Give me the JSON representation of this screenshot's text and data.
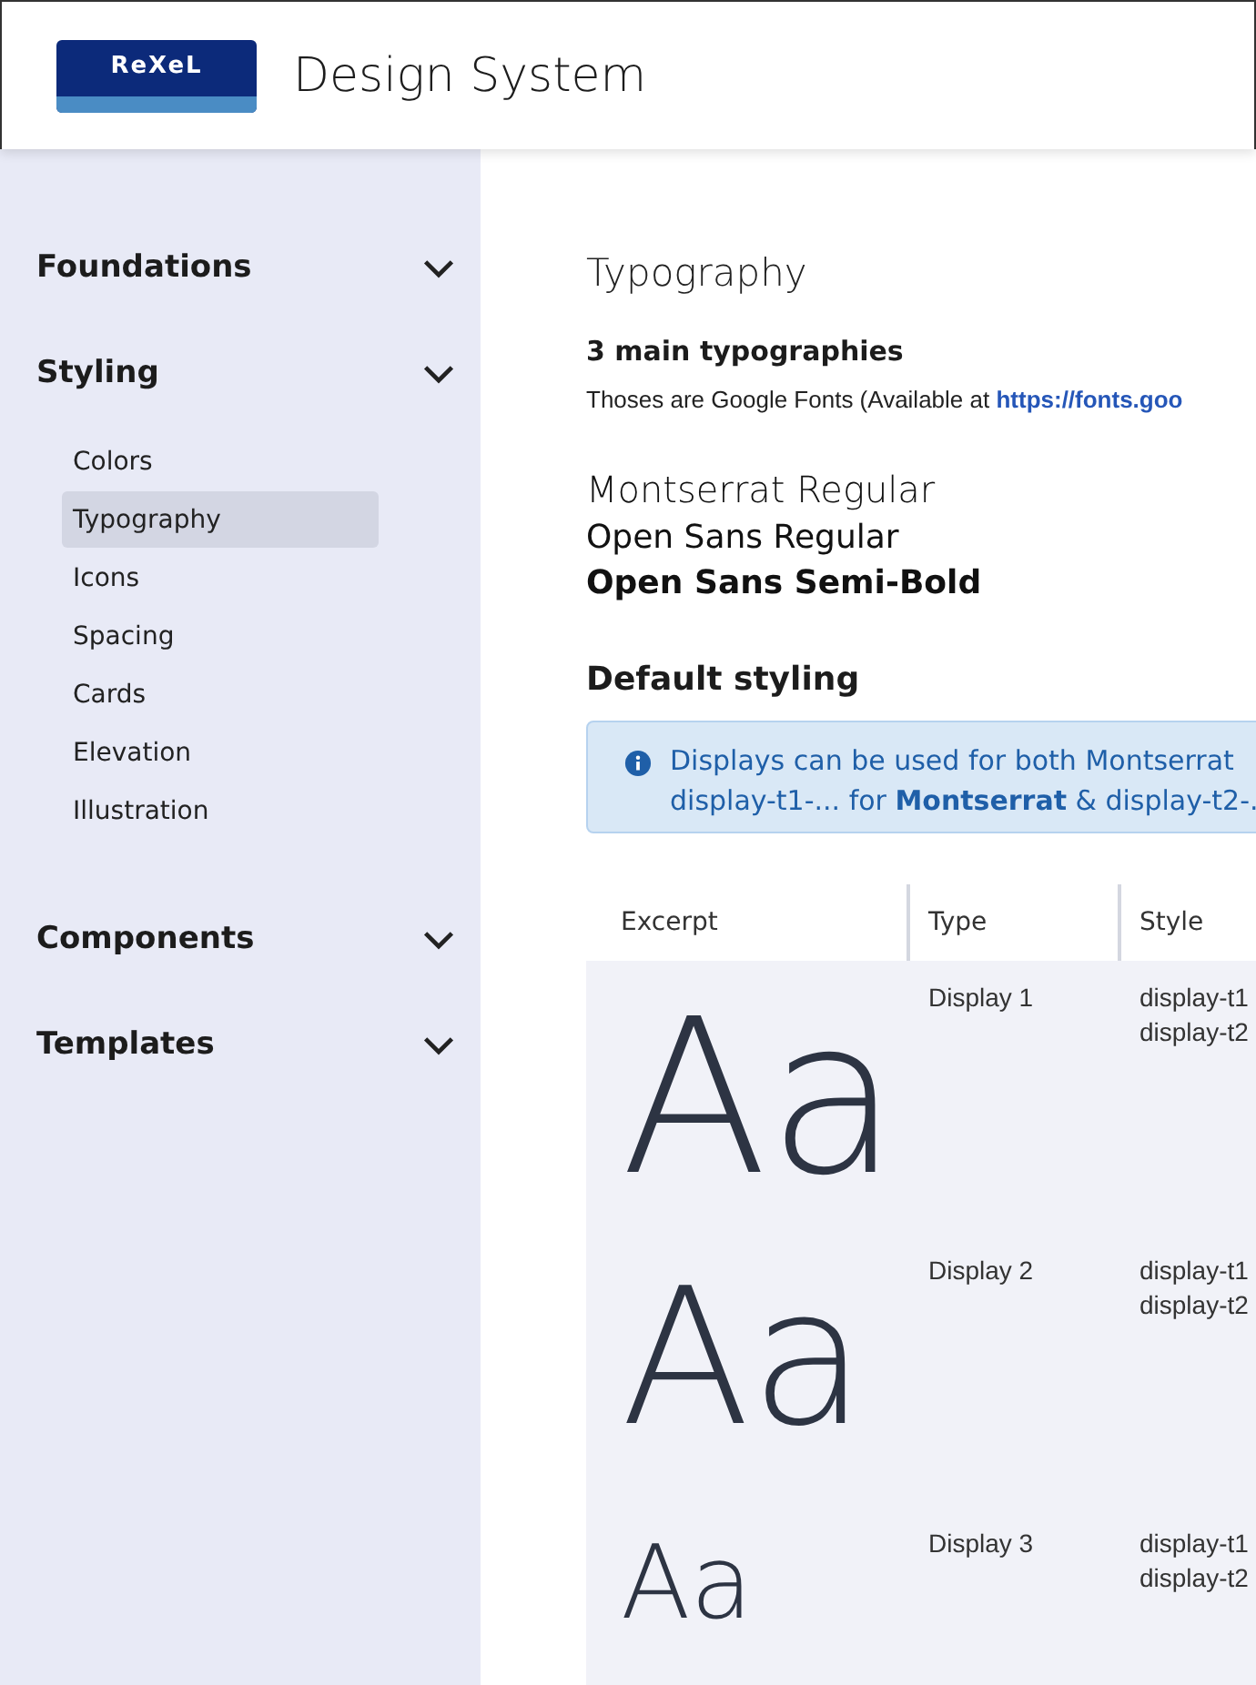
{
  "header": {
    "logo": "ReXeL",
    "title": "Design System"
  },
  "sidebar": {
    "groups": [
      {
        "label": "Foundations"
      },
      {
        "label": "Styling",
        "children": [
          {
            "label": "Colors",
            "selected": false
          },
          {
            "label": "Typography",
            "selected": true
          },
          {
            "label": "Icons",
            "selected": false
          },
          {
            "label": "Spacing",
            "selected": false
          },
          {
            "label": "Cards",
            "selected": false
          },
          {
            "label": "Elevation",
            "selected": false
          },
          {
            "label": "Illustration",
            "selected": false
          }
        ]
      },
      {
        "label": "Components"
      },
      {
        "label": "Templates"
      }
    ]
  },
  "page": {
    "title": "Typography",
    "subtitle": "3 main typographies",
    "intro": "Thoses are Google Fonts (Available at ",
    "intro_link": "https://fonts.goo",
    "fonts": [
      {
        "label": "Montserrat Regular",
        "kind": "montserrat"
      },
      {
        "label": "Open Sans Regular",
        "kind": "regular"
      },
      {
        "label": "Open Sans Semi-Bold",
        "kind": "semibold"
      }
    ],
    "section": "Default styling",
    "alert": {
      "lines": [
        "Displays can be used for both Montserrat",
        "display-t1-... for **Montserrat** & display-t2-."
      ]
    },
    "table": {
      "columns": [
        "Excerpt",
        "Type",
        "Style"
      ],
      "rows": [
        {
          "excerpt": "Aa",
          "type": "Display 1",
          "styles": [
            "display-t1",
            "display-t2"
          ]
        },
        {
          "excerpt": "Aa",
          "type": "Display 2",
          "styles": [
            "display-t1",
            "display-t2"
          ]
        },
        {
          "excerpt": "Aa",
          "type": "Display 3",
          "styles": [
            "display-t1",
            "display-t2"
          ]
        }
      ]
    }
  }
}
